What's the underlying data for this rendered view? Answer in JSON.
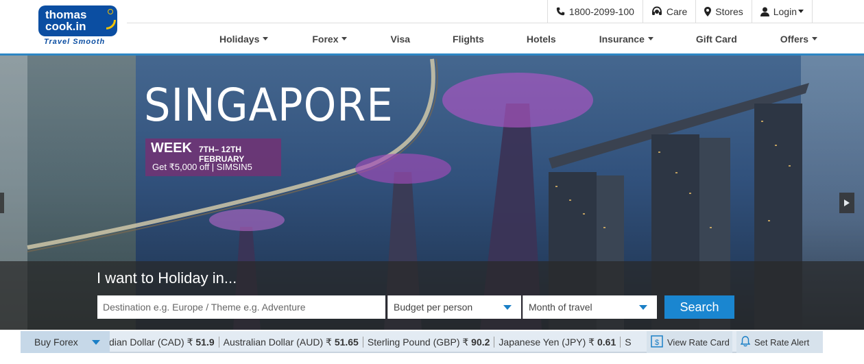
{
  "header": {
    "logo_line1": "thomas",
    "logo_line2": "cook.in",
    "tagline": "Travel Smooth",
    "top_links": {
      "phone": "1800-2099-100",
      "care": "Care",
      "stores": "Stores",
      "login": "Login"
    }
  },
  "nav": {
    "items": [
      {
        "label": "Holidays",
        "dropdown": true
      },
      {
        "label": "Forex",
        "dropdown": true
      },
      {
        "label": "Visa",
        "dropdown": false
      },
      {
        "label": "Flights",
        "dropdown": false
      },
      {
        "label": "Hotels",
        "dropdown": false
      },
      {
        "label": "Insurance",
        "dropdown": true
      },
      {
        "label": "Gift Card",
        "dropdown": false
      },
      {
        "label": "Offers",
        "dropdown": true
      }
    ]
  },
  "hero": {
    "promo_title": "SINGAPORE",
    "promo_week": "WEEK",
    "promo_dates": "7TH– 12TH FEBRUARY",
    "promo_offer": "Get ₹5,000 off | SIMSIN5",
    "search_heading": "I want to Holiday in...",
    "destination_placeholder": "Destination e.g. Europe / Theme e.g. Adventure",
    "budget_label": "Budget per person",
    "month_label": "Month of travel",
    "search_button": "Search"
  },
  "forex": {
    "buy_label": "Buy Forex",
    "rates": [
      {
        "currency": "Canadian Dollar (CAD)",
        "display": "dian Dollar (CAD) ₹",
        "value": "51.9"
      },
      {
        "currency": "Australian Dollar (AUD)",
        "display": "Australian Dollar (AUD) ₹",
        "value": "51.65"
      },
      {
        "currency": "Sterling Pound (GBP)",
        "display": "Sterling Pound (GBP) ₹",
        "value": "90.2"
      },
      {
        "currency": "Japanese Yen (JPY)",
        "display": "Japanese Yen (JPY) ₹",
        "value": "0.61"
      },
      {
        "currency": "S",
        "display": "S",
        "value": ""
      }
    ],
    "view_rate_card": "View Rate Card",
    "set_rate_alert": "Set Rate Alert"
  },
  "colors": {
    "brand_blue": "#0b4ea2",
    "accent_blue": "#1a86d0",
    "promo_purple": "#6f3474",
    "logo_yellow": "#f5c400"
  }
}
